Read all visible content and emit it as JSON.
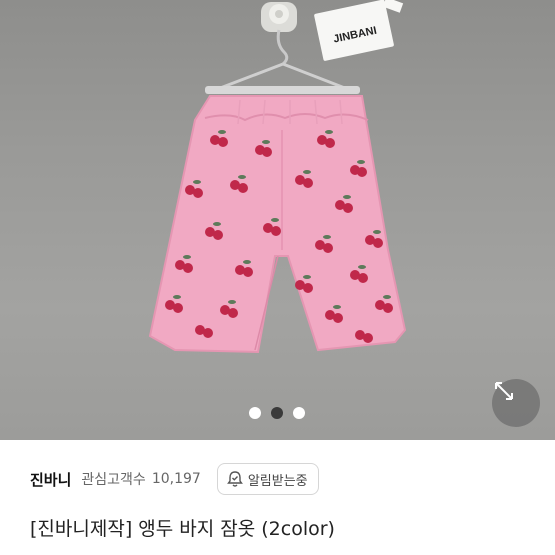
{
  "product_image": {
    "alt": "Pink cherry-print pajama shorts on hanger",
    "tag_text": "JINBANI",
    "carousel": {
      "count": 3,
      "active_index": 1
    }
  },
  "seller": {
    "name": "진바니",
    "followers_label": "관심고객수",
    "followers_count": "10,197",
    "notify_label": "알림받는중"
  },
  "product": {
    "title": "[진바니제작] 앵두 바지 잠옷 (2color)"
  },
  "icons": {
    "expand": "expand-arrows-icon",
    "notify": "bell-check-icon"
  },
  "colors": {
    "shorts_pink": "#f1a9c3",
    "cherry_red": "#c0284a",
    "background_gray": "#9a9a98"
  }
}
